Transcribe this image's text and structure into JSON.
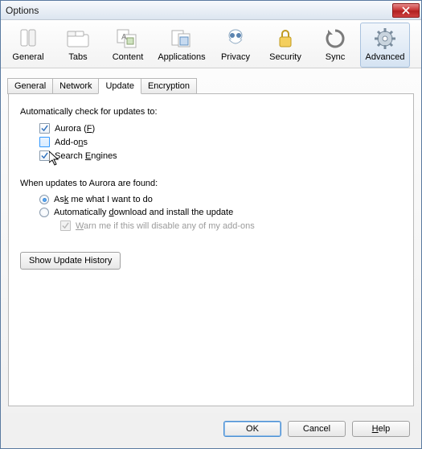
{
  "title": "Options",
  "toolbar": [
    {
      "label": "General"
    },
    {
      "label": "Tabs"
    },
    {
      "label": "Content"
    },
    {
      "label": "Applications"
    },
    {
      "label": "Privacy"
    },
    {
      "label": "Security"
    },
    {
      "label": "Sync"
    },
    {
      "label": "Advanced"
    }
  ],
  "subtabs": [
    {
      "label": "General"
    },
    {
      "label": "Network"
    },
    {
      "label": "Update"
    },
    {
      "label": "Encryption"
    }
  ],
  "update": {
    "autoCheckLabel": "Automatically check for updates to:",
    "items": [
      {
        "label_pre": "Aurora (",
        "accel": "F",
        "label_post": ")",
        "checked": true
      },
      {
        "label_pre": "Add-o",
        "accel": "n",
        "label_post": "s",
        "checked": false
      },
      {
        "label_pre": "Search ",
        "accel": "E",
        "label_post": "ngines",
        "checked": true
      }
    ],
    "foundLabel": "When updates to Aurora are found:",
    "radios": [
      {
        "label_pre": "As",
        "accel": "k",
        "label_post": " me what I want to do",
        "checked": true
      },
      {
        "label_pre": "Automatically ",
        "accel": "d",
        "label_post": "ownload and install the update",
        "checked": false
      }
    ],
    "warn": {
      "label_pre": "",
      "accel": "W",
      "label_post": "arn me if this will disable any of my add-ons",
      "checked": true
    },
    "historyBtn": "Show Update History"
  },
  "buttons": {
    "ok": "OK",
    "cancel": "Cancel",
    "help_accel": "H",
    "help_post": "elp"
  }
}
